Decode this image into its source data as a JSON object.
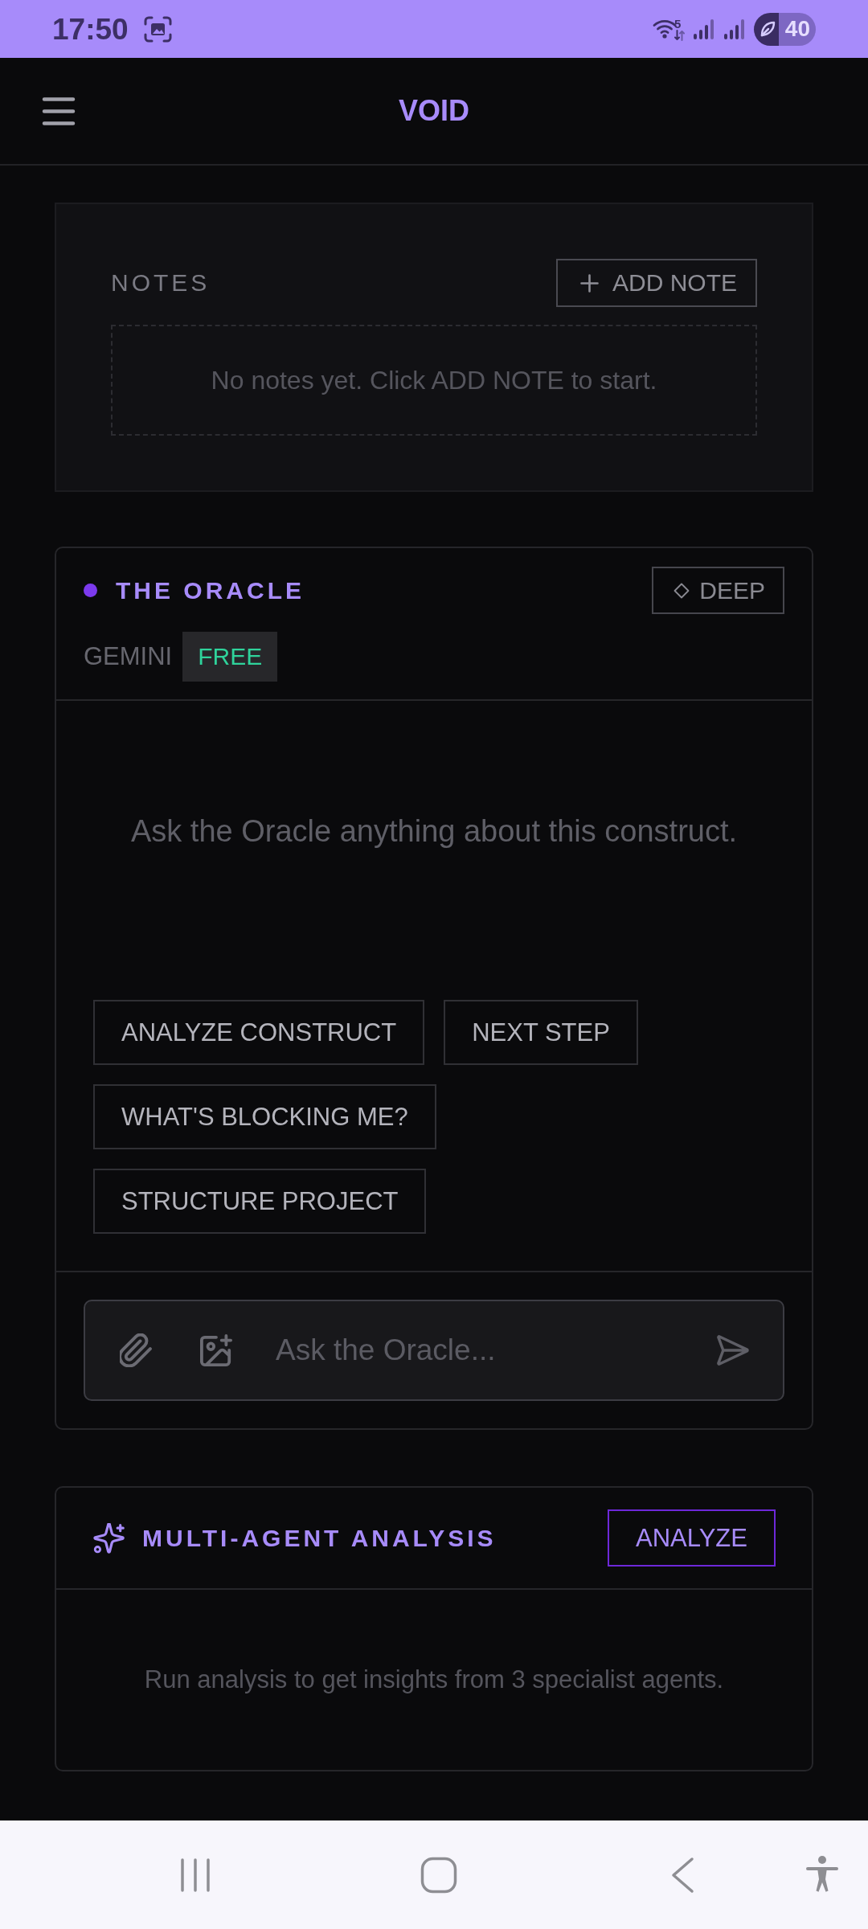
{
  "status_bar": {
    "time": "17:50",
    "network_type": "5",
    "battery": "40"
  },
  "header": {
    "title": "VOID"
  },
  "notes": {
    "title": "NOTES",
    "add_button": "ADD NOTE",
    "empty_message": "No notes yet. Click ADD NOTE to start."
  },
  "oracle": {
    "title": "THE ORACLE",
    "mode_button": "DEEP",
    "model": "GEMINI",
    "tier": "FREE",
    "prompt": "Ask the Oracle anything about this construct.",
    "suggestions": [
      "ANALYZE CONSTRUCT",
      "NEXT STEP",
      "WHAT'S BLOCKING ME?",
      "STRUCTURE PROJECT"
    ],
    "input": {
      "placeholder": "Ask the Oracle..."
    }
  },
  "multi_agent": {
    "title": "MULTI-AGENT ANALYSIS",
    "button": "ANALYZE",
    "empty_message": "Run analysis to get insights from 3 specialist agents."
  }
}
